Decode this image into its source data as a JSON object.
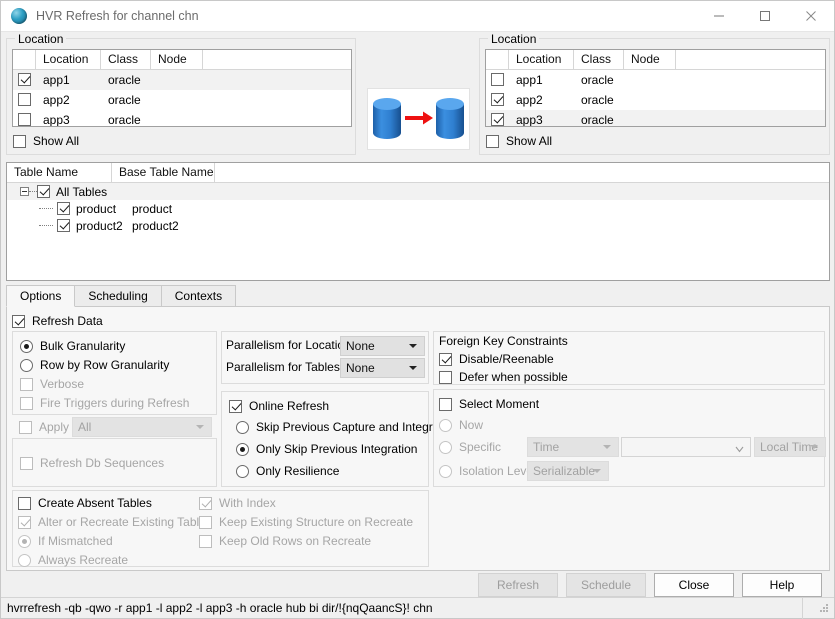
{
  "window": {
    "title": "HVR Refresh for channel chn",
    "app_icon": "globe-icon",
    "minimize": "minimize-icon",
    "maximize": "maximize-icon",
    "close": "close-icon"
  },
  "source_location": {
    "legend": "Location",
    "columns": [
      "",
      "Location",
      "Class",
      "Node"
    ],
    "rows": [
      {
        "checked": true,
        "location": "app1",
        "class": "oracle",
        "node": "",
        "selected": true
      },
      {
        "checked": false,
        "location": "app2",
        "class": "oracle",
        "node": "",
        "selected": false
      },
      {
        "checked": false,
        "location": "app3",
        "class": "oracle",
        "node": "",
        "selected": false
      }
    ],
    "show_all_label": "Show All",
    "show_all_checked": false
  },
  "target_location": {
    "legend": "Location",
    "columns": [
      "",
      "Location",
      "Class",
      "Node"
    ],
    "rows": [
      {
        "checked": false,
        "location": "app1",
        "class": "oracle",
        "node": "",
        "selected": false
      },
      {
        "checked": true,
        "location": "app2",
        "class": "oracle",
        "node": "",
        "selected": false
      },
      {
        "checked": true,
        "location": "app3",
        "class": "oracle",
        "node": "",
        "selected": true
      }
    ],
    "show_all_label": "Show All",
    "show_all_checked": false
  },
  "transfer_graphic": {
    "name": "database-to-database-arrow",
    "source_db": "source-database-cylinder",
    "target_db": "target-database-cylinder",
    "arrow": "red-right-arrow",
    "cylinder_color": "#2f86d8",
    "arrow_color": "#ee1111"
  },
  "tables": {
    "columns": [
      "Table Name",
      "Base Table Name"
    ],
    "root": {
      "label": "All Tables",
      "checked": true,
      "base": ""
    },
    "rows": [
      {
        "name": "product",
        "base": "product",
        "checked": true
      },
      {
        "name": "product2",
        "base": "product2",
        "checked": true
      }
    ]
  },
  "tabs": [
    {
      "label": "Options",
      "active": true
    },
    {
      "label": "Scheduling",
      "active": false
    },
    {
      "label": "Contexts",
      "active": false
    }
  ],
  "options": {
    "refresh_data": {
      "label": "Refresh Data",
      "checked": true,
      "enabled": true
    },
    "granularity": {
      "bulk": {
        "label": "Bulk Granularity",
        "checked": true,
        "enabled": true
      },
      "row_by_row": {
        "label": "Row by Row Granularity",
        "checked": false,
        "enabled": true
      },
      "verbose": {
        "label": "Verbose",
        "checked": false,
        "enabled": false
      },
      "fire_triggers": {
        "label": "Fire Triggers during Refresh",
        "checked": false,
        "enabled": false
      },
      "apply": {
        "label": "Apply",
        "checked": false,
        "enabled": false
      },
      "apply_value": "All"
    },
    "refresh_db_sequences": {
      "label": "Refresh Db Sequences",
      "checked": false,
      "enabled": false
    },
    "parallelism": {
      "locations_label": "Parallelism for Locations",
      "locations_value": "None",
      "tables_label": "Parallelism for Tables",
      "tables_value": "None"
    },
    "online_refresh": {
      "label": "Online Refresh",
      "checked": true,
      "choices": [
        {
          "label": "Skip Previous Capture and Integration",
          "checked": false
        },
        {
          "label": "Only Skip Previous Integration",
          "checked": true
        },
        {
          "label": "Only Resilience",
          "checked": false
        }
      ]
    },
    "foreign_key": {
      "legend": "Foreign Key Constraints",
      "disable_reenable": {
        "label": "Disable/Reenable",
        "checked": true
      },
      "defer_when_possible": {
        "label": "Defer when possible",
        "checked": false
      }
    },
    "select_moment": {
      "label": "Select Moment",
      "checked": false,
      "now": {
        "label": "Now",
        "checked": false,
        "enabled": false
      },
      "specific": {
        "label": "Specific",
        "checked": false,
        "enabled": false
      },
      "specific_type": "Time",
      "specific_value": "",
      "timezone": "Local Time",
      "isolation": {
        "label": "Isolation Level",
        "checked": false,
        "enabled": false
      },
      "isolation_value": "Serializable"
    },
    "recreate": {
      "create_absent_tables": {
        "label": "Create Absent Tables",
        "checked": false,
        "enabled": true
      },
      "alter_or_recreate": {
        "label": "Alter or Recreate Existing Tables",
        "checked": true,
        "enabled": false
      },
      "if_mismatched": {
        "label": "If Mismatched",
        "checked": true,
        "enabled": false
      },
      "always_recreate": {
        "label": "Always Recreate",
        "checked": false,
        "enabled": false
      },
      "with_index": {
        "label": "With Index",
        "checked": true,
        "enabled": false
      },
      "keep_existing_structure": {
        "label": "Keep Existing Structure on Recreate",
        "checked": false,
        "enabled": false
      },
      "keep_old_rows": {
        "label": "Keep Old Rows on Recreate",
        "checked": false,
        "enabled": false
      }
    }
  },
  "buttons": {
    "refresh": {
      "label": "Refresh",
      "enabled": false
    },
    "schedule": {
      "label": "Schedule",
      "enabled": false
    },
    "close": {
      "label": "Close",
      "enabled": true
    },
    "help": {
      "label": "Help",
      "enabled": true
    }
  },
  "statusbar": {
    "command": "hvrrefresh -qb -qwo -r app1 -l app2 -l app3 -h oracle hub  bi  dir/!{nqQaancS}! chn"
  }
}
